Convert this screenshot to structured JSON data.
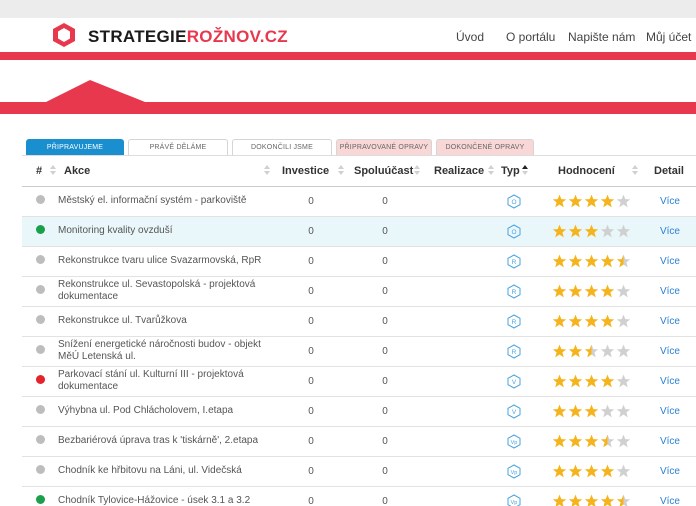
{
  "brand": {
    "part1": "STRATEGIE",
    "part2": "ROŽNOV.CZ"
  },
  "nav": [
    "Úvod",
    "O portálu",
    "Napište nám",
    "Můj účet"
  ],
  "tabs": [
    {
      "label": "PŘIPRAVUJEME",
      "bg": "#1a8fd0",
      "fg": "#ffffff"
    },
    {
      "label": "PRÁVĚ DĚLÁME",
      "bg": "#ffffff",
      "fg": "#666666"
    },
    {
      "label": "DOKONČILI JSME",
      "bg": "#ffffff",
      "fg": "#666666"
    },
    {
      "label": "PŘIPRAVOVANÉ OPRAVY",
      "bg": "#f9d7d7",
      "fg": "#666666"
    },
    {
      "label": "DOKONČENÉ OPRAVY",
      "bg": "#f9d7d7",
      "fg": "#666666"
    }
  ],
  "columns": {
    "num": "#",
    "akce": "Akce",
    "investice": "Investice",
    "spoluucast": "Spoluúčast",
    "realizace": "Realizace",
    "typ": "Typ",
    "hodnoceni": "Hodnocení",
    "detail": "Detail"
  },
  "colors": {
    "accent": "#e8384d",
    "link": "#2a7fd4",
    "type_icon": "#4aa3e0",
    "star": "#f5b31c",
    "star_empty": "#d0d0d0",
    "status_grey": "#bdbdbd",
    "status_green": "#1aa04a",
    "status_red": "#e5232b"
  },
  "rows": [
    {
      "status": "grey",
      "akce": "Městský el. informační systém - parkoviště",
      "investice": "0",
      "spoluucast": "0",
      "typ": "O",
      "rating": 4,
      "detail": "Více"
    },
    {
      "status": "green",
      "akce": "Monitoring kvality ovzduší",
      "investice": "0",
      "spoluucast": "0",
      "typ": "O",
      "rating": 3,
      "detail": "Více",
      "highlight": true
    },
    {
      "status": "grey",
      "akce": "Rekonstrukce tvaru ulice Svazarmovská, RpR",
      "investice": "0",
      "spoluucast": "0",
      "typ": "R",
      "rating": 4.5,
      "detail": "Více"
    },
    {
      "status": "grey",
      "akce": "Rekonstrukce ul. Sevastopolská - projektová dokumentace",
      "investice": "0",
      "spoluucast": "0",
      "typ": "R",
      "rating": 4,
      "detail": "Více"
    },
    {
      "status": "grey",
      "akce": "Rekonstrukce ul. Tvarůžkova",
      "investice": "0",
      "spoluucast": "0",
      "typ": "R",
      "rating": 4,
      "detail": "Více"
    },
    {
      "status": "grey",
      "akce": "Snížení energetické náročnosti budov - objekt MěÚ Letenská ul.",
      "investice": "0",
      "spoluucast": "0",
      "typ": "R",
      "rating": 2.5,
      "detail": "Více"
    },
    {
      "status": "red",
      "akce": "Parkovací stání ul. Kulturní III - projektová dokumentace",
      "investice": "0",
      "spoluucast": "0",
      "typ": "V",
      "rating": 4,
      "detail": "Více"
    },
    {
      "status": "grey",
      "akce": "Výhybna ul. Pod Chlácholovem, I.etapa",
      "investice": "0",
      "spoluucast": "0",
      "typ": "V",
      "rating": 3,
      "detail": "Více"
    },
    {
      "status": "grey",
      "akce": "Bezbariérová úprava tras k 'tiskárně', 2.etapa",
      "investice": "0",
      "spoluucast": "0",
      "typ": "Vp",
      "rating": 3.5,
      "detail": "Více"
    },
    {
      "status": "grey",
      "akce": "Chodník ke hřbitovu na Láni, ul. Videčská",
      "investice": "0",
      "spoluucast": "0",
      "typ": "Vp",
      "rating": 4,
      "detail": "Více"
    },
    {
      "status": "green",
      "akce": "Chodník Tylovice-Hážovice - úsek 3.1 a 3.2",
      "investice": "0",
      "spoluucast": "0",
      "typ": "Vp",
      "rating": 4.5,
      "detail": "Více"
    }
  ]
}
